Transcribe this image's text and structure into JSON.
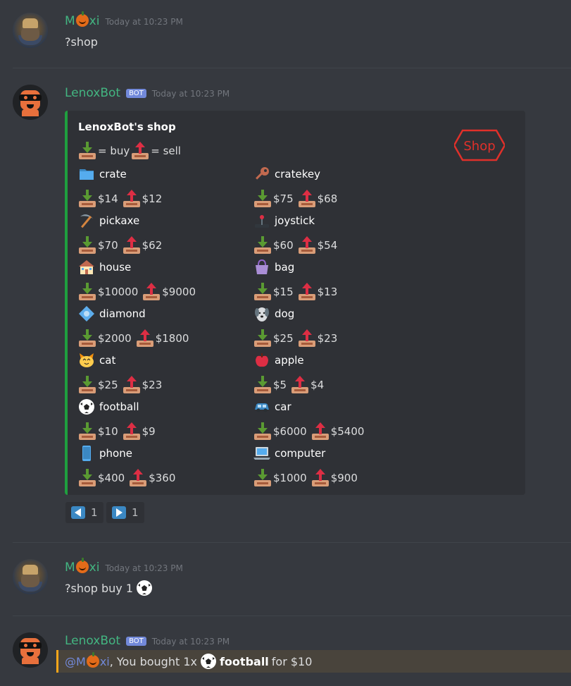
{
  "messages": {
    "m1": {
      "username": "M",
      "username_suffix": "xi",
      "timestamp": "Today at 10:23 PM",
      "text": "?shop"
    },
    "m2": {
      "username": "LenoxBot",
      "badge": "BOT",
      "timestamp": "Today at 10:23 PM"
    },
    "m3": {
      "username": "M",
      "username_suffix": "xi",
      "timestamp": "Today at 10:23 PM",
      "text": "?shop buy 1"
    },
    "m4": {
      "username": "LenoxBot",
      "badge": "BOT",
      "timestamp": "Today at 10:23 PM",
      "mention_prefix": "@M",
      "mention_suffix": "xi",
      "text_a": ", You bought 1x",
      "item": "football",
      "text_b": "for $10"
    }
  },
  "embed": {
    "title": "LenoxBot's shop",
    "legend_buy": "= buy",
    "legend_sell": "= sell",
    "logo_text": "Shop",
    "accent_color": "#1f9f3f",
    "items": [
      {
        "name": "crate",
        "icon": "folder-icon",
        "buy": "$14",
        "sell": "$12"
      },
      {
        "name": "cratekey",
        "icon": "key-icon",
        "buy": "$75",
        "sell": "$68"
      },
      {
        "name": "pickaxe",
        "icon": "pickaxe-icon",
        "buy": "$70",
        "sell": "$62"
      },
      {
        "name": "joystick",
        "icon": "joystick-icon",
        "buy": "$60",
        "sell": "$54"
      },
      {
        "name": "house",
        "icon": "house-icon",
        "buy": "$10000",
        "sell": "$9000"
      },
      {
        "name": "bag",
        "icon": "bag-icon",
        "buy": "$15",
        "sell": "$13"
      },
      {
        "name": "diamond",
        "icon": "diamond-icon",
        "buy": "$2000",
        "sell": "$1800"
      },
      {
        "name": "dog",
        "icon": "dog-icon",
        "buy": "$25",
        "sell": "$23"
      },
      {
        "name": "cat",
        "icon": "cat-icon",
        "buy": "$25",
        "sell": "$23"
      },
      {
        "name": "apple",
        "icon": "apple-icon",
        "buy": "$5",
        "sell": "$4"
      },
      {
        "name": "football",
        "icon": "football-icon",
        "buy": "$10",
        "sell": "$9"
      },
      {
        "name": "car",
        "icon": "car-icon",
        "buy": "$6000",
        "sell": "$5400"
      },
      {
        "name": "phone",
        "icon": "phone-icon",
        "buy": "$400",
        "sell": "$360"
      },
      {
        "name": "computer",
        "icon": "computer-icon",
        "buy": "$1000",
        "sell": "$900"
      }
    ]
  },
  "reactions": [
    {
      "icon": "arrow-left-icon",
      "count": "1"
    },
    {
      "icon": "arrow-right-icon",
      "count": "1"
    }
  ],
  "colors": {
    "background": "#36393f",
    "embed": "#2f3136",
    "username_green": "#43b581",
    "mention": "#7289da",
    "highlight_border": "#faa61a"
  }
}
